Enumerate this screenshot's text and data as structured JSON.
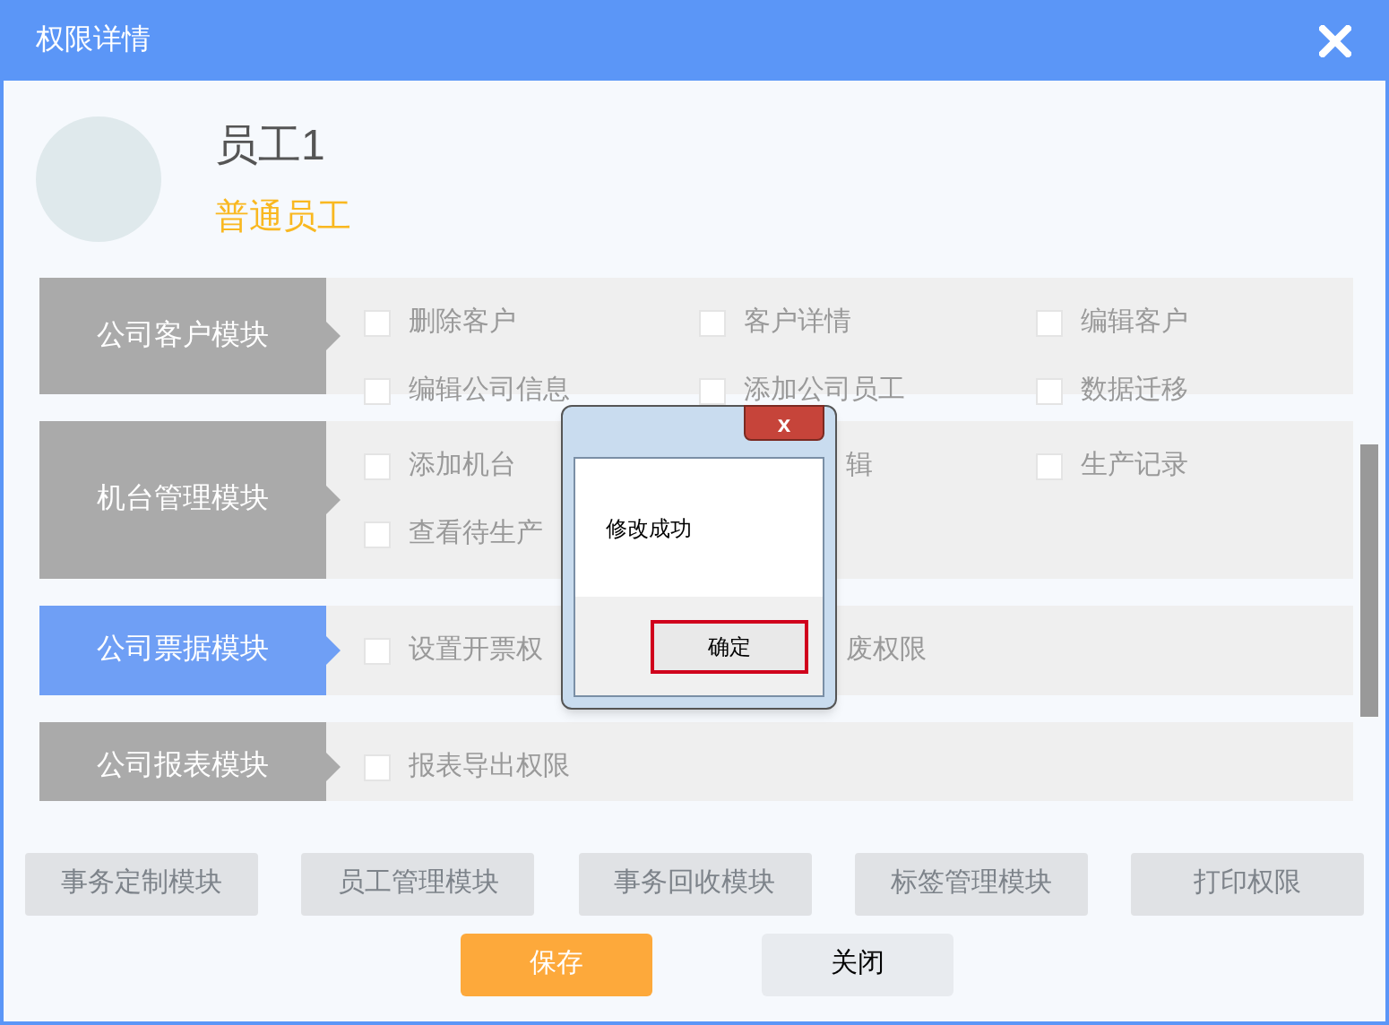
{
  "window": {
    "title": "权限详情"
  },
  "user": {
    "name": "员工1",
    "role": "普通员工"
  },
  "modules": [
    {
      "label": "公司客户模块",
      "selected": false,
      "items": [
        {
          "kind": "full",
          "label": "删除客户",
          "checked": false
        },
        {
          "kind": "full",
          "label": "客户详情",
          "checked": false
        },
        {
          "kind": "full",
          "label": "编辑客户",
          "checked": false
        },
        {
          "kind": "full",
          "label": "编辑公司信息",
          "checked": false
        },
        {
          "kind": "full",
          "label": "添加公司员工",
          "checked": false
        },
        {
          "kind": "full",
          "label": "数据迁移",
          "checked": false
        }
      ]
    },
    {
      "label": "机台管理模块",
      "selected": false,
      "items": [
        {
          "kind": "full",
          "label": "添加机台",
          "checked": false
        },
        {
          "kind": "tail",
          "label": "辑"
        },
        {
          "kind": "full",
          "label": "生产记录",
          "checked": false
        },
        {
          "kind": "full",
          "label": "查看待生产",
          "checked": false
        }
      ]
    },
    {
      "label": "公司票据模块",
      "selected": true,
      "items": [
        {
          "kind": "full",
          "label": "设置开票权",
          "checked": false
        },
        {
          "kind": "tail",
          "label": "废权限"
        }
      ]
    },
    {
      "label": "公司报表模块",
      "selected": false,
      "items": [
        {
          "kind": "full",
          "label": "报表导出权限",
          "checked": false
        }
      ]
    }
  ],
  "module_tabs": [
    "事务定制模块",
    "员工管理模块",
    "事务回收模块",
    "标签管理模块",
    "打印权限"
  ],
  "buttons": [
    {
      "kind": "primary",
      "label": "保存"
    },
    {
      "kind": "secondary",
      "label": "关闭"
    }
  ],
  "message_box": {
    "close": "x",
    "message": "修改成功",
    "button": "确定"
  }
}
